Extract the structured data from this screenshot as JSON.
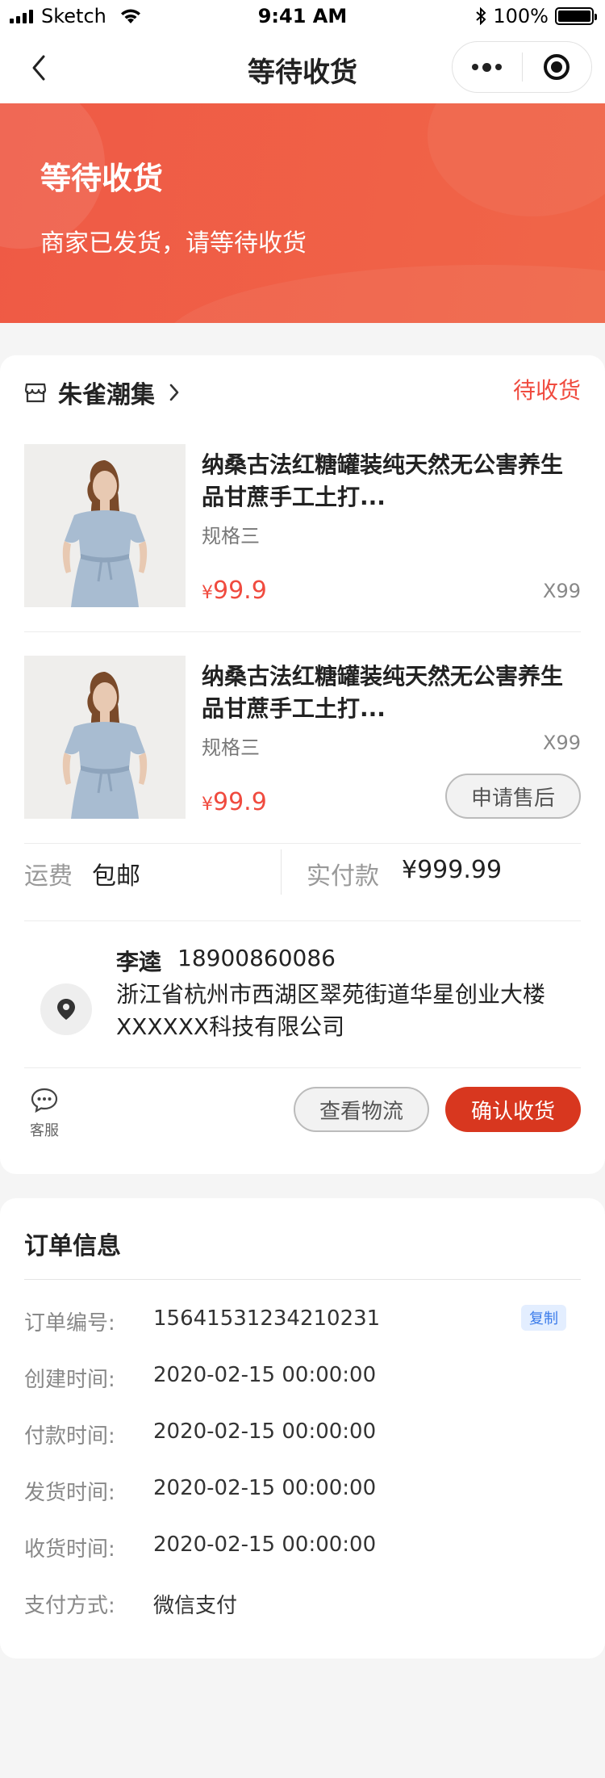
{
  "status_bar": {
    "carrier": "Sketch",
    "time": "9:41 AM",
    "battery": "100%"
  },
  "nav": {
    "title": "等待收货"
  },
  "hero": {
    "title": "等待收货",
    "subtitle": "商家已发货，请等待收货"
  },
  "order": {
    "shop_name": "朱雀潮集",
    "status": "待收货",
    "items": [
      {
        "name": "纳桑古法红糖罐装纯天然无公害养生品甘蔗手工土打...",
        "spec": "规格三",
        "currency": "¥",
        "price": "99.9",
        "qty": "X99"
      },
      {
        "name": "纳桑古法红糖罐装纯天然无公害养生品甘蔗手工土打...",
        "spec": "规格三",
        "currency": "¥",
        "price": "99.9",
        "qty": "X99",
        "after_sale_label": "申请售后"
      }
    ],
    "shipping_label": "运费",
    "shipping_value": "包邮",
    "paid_label": "实付款",
    "paid_value": "¥999.99",
    "address": {
      "name": "李逵",
      "phone": "18900860086",
      "line1": "浙江省杭州市西湖区翠苑街道华星创业大楼",
      "line2": "XXXXXX科技有限公司"
    },
    "customer_service_label": "客服",
    "logistics_label": "查看物流",
    "confirm_label": "确认收货"
  },
  "order_info": {
    "title": "订单信息",
    "copy_label": "复制",
    "rows": [
      {
        "label": "订单编号:",
        "value": "15641531234210231"
      },
      {
        "label": "创建时间:",
        "value": "2020-02-15  00:00:00"
      },
      {
        "label": "付款时间:",
        "value": "2020-02-15  00:00:00"
      },
      {
        "label": "发货时间:",
        "value": "2020-02-15  00:00:00"
      },
      {
        "label": "收货时间:",
        "value": "2020-02-15  00:00:00"
      },
      {
        "label": "支付方式:",
        "value": "微信支付"
      }
    ]
  },
  "colors": {
    "hero": "#ef5a45",
    "accent_red": "#f04b3f",
    "confirm_button": "#d8371f",
    "copy_badge_bg": "#e3eeff"
  }
}
